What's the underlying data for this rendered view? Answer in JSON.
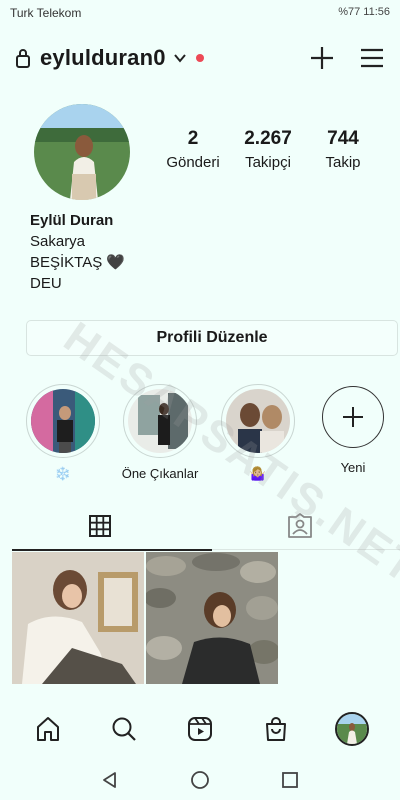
{
  "status_bar": {
    "carrier": "Turk Telekom",
    "right": "%77 11:56"
  },
  "header": {
    "username": "eylulduran0"
  },
  "stats": [
    {
      "value": "2",
      "label": "Gönderi"
    },
    {
      "value": "2.267",
      "label": "Takipçi"
    },
    {
      "value": "744",
      "label": "Takip"
    }
  ],
  "bio": {
    "name": "Eylül Duran",
    "line1": "Sakarya",
    "line2": "BEŞİKTAŞ 🖤",
    "line3": "DEU"
  },
  "edit_profile_label": "Profili Düzenle",
  "highlights": [
    {
      "label": "❄️"
    },
    {
      "label": "Öne Çıkanlar"
    },
    {
      "label": "🤷🏼‍♀️"
    },
    {
      "label": "Yeni"
    }
  ],
  "watermark": "HESAPSATIŞ.NET",
  "colors": {
    "accent_dot": "#ed4956",
    "background": "#f1fffb"
  }
}
